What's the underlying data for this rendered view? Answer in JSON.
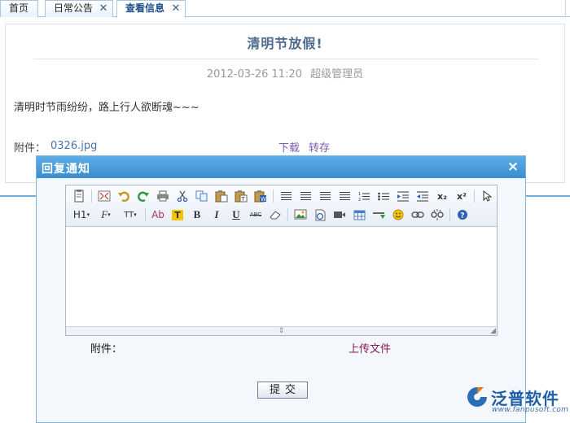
{
  "tabs": [
    {
      "label": "首页",
      "active": false,
      "closable": false
    },
    {
      "label": "日常公告",
      "active": false,
      "closable": true
    },
    {
      "label": "查看信息",
      "active": true,
      "closable": true
    }
  ],
  "article": {
    "title": "清明节放假!",
    "date": "2012-03-26 11:20",
    "author": "超级管理员",
    "body": "清明时节雨纷纷，路上行人欲断魂~~~",
    "attachment_label": "附件：",
    "attachment_file": "0326.jpg",
    "download_label": "下载",
    "forward_label": "转存"
  },
  "dialog": {
    "title": "回复通知",
    "attachment_label": "附件：",
    "upload_label": "上传文件",
    "submit_label": "提交",
    "close_symbol": "×"
  },
  "editor": {
    "heading_label": "H1",
    "font_label": "F",
    "size_label": "TT",
    "font_color_label": "Ab",
    "highlight_label": "T",
    "bold_label": "B",
    "italic_label": "I",
    "underline_label": "U",
    "strike_label": "ABC",
    "subscript_label": "x₂",
    "superscript_label": "x²"
  },
  "watermark": {
    "brand": "泛普软件",
    "url": "www.fanpusoft.com"
  },
  "colors": {
    "dialog_header": "#3a8dd0",
    "title_text": "#4d6b8a",
    "link": "#7a59b5",
    "upload_link": "#8a1a5a",
    "brand": "#1f5fa8"
  }
}
